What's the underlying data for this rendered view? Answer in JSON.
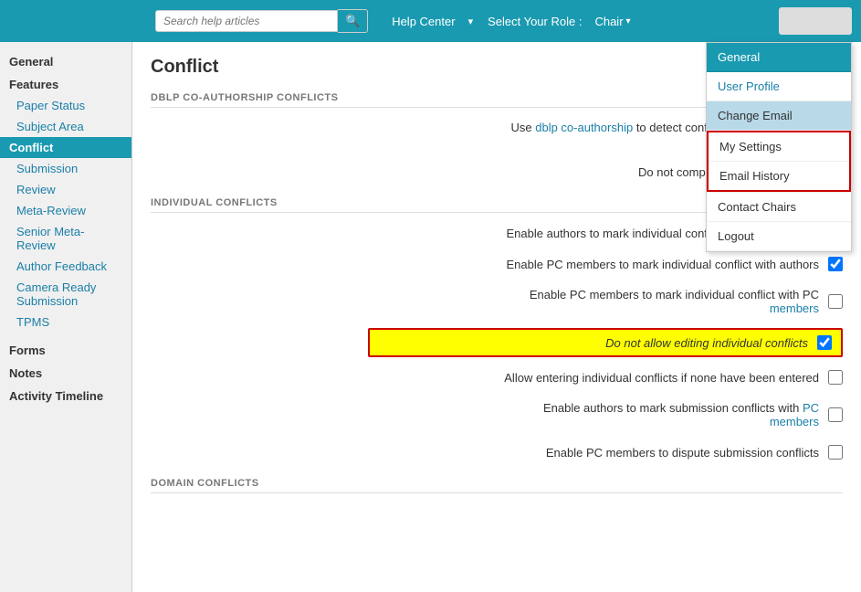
{
  "navbar": {
    "search_placeholder": "Search help articles",
    "help_center_label": "Help Center",
    "select_role_label": "Select Your Role :",
    "chair_label": "Chair",
    "search_icon": "🔍"
  },
  "dropdown": {
    "top_items": [
      {
        "id": "general",
        "label": "General",
        "active": true
      },
      {
        "id": "user-profile",
        "label": "User Profile"
      },
      {
        "id": "change-email",
        "label": "Change Email"
      }
    ],
    "section_items": [
      {
        "id": "my-settings",
        "label": "My Settings"
      },
      {
        "id": "email-history",
        "label": "Email History"
      }
    ],
    "bottom_items": [
      {
        "id": "contact-chairs",
        "label": "Contact Chairs"
      },
      {
        "id": "logout",
        "label": "Logout"
      }
    ]
  },
  "sidebar": {
    "sections": [
      {
        "id": "general",
        "label": "General",
        "items": []
      },
      {
        "id": "features",
        "label": "Features",
        "items": [
          {
            "id": "paper-status",
            "label": "Paper Status",
            "active": false
          },
          {
            "id": "subject-area",
            "label": "Subject Area",
            "active": false
          },
          {
            "id": "conflict",
            "label": "Conflict",
            "active": true
          },
          {
            "id": "submission",
            "label": "Submission",
            "active": false
          },
          {
            "id": "review",
            "label": "Review",
            "active": false
          },
          {
            "id": "meta-review",
            "label": "Meta-Review",
            "active": false
          },
          {
            "id": "senior-meta-review",
            "label": "Senior Meta-Review",
            "active": false
          },
          {
            "id": "author-feedback",
            "label": "Author Feedback",
            "active": false
          },
          {
            "id": "camera-ready",
            "label": "Camera Ready Submission",
            "active": false
          },
          {
            "id": "tpms",
            "label": "TPMS",
            "active": false
          }
        ]
      },
      {
        "id": "forms-section",
        "label": "Forms",
        "items": []
      },
      {
        "id": "notes-section",
        "label": "Notes",
        "items": []
      },
      {
        "id": "activity-timeline-section",
        "label": "Activity Timeline",
        "items": []
      }
    ]
  },
  "main": {
    "title": "Conflict",
    "dblp_section": {
      "header": "DBLP CO-AUTHORSHIP CONFLICTS",
      "rows": [
        {
          "id": "dblp-detect",
          "label": "Use dblp co-authorship to detect conflicts between authors and PC members",
          "checked": false
        },
        {
          "id": "dblp-no-compute",
          "label": "Do not compute new dblp conflicts",
          "checked": false
        }
      ]
    },
    "individual_section": {
      "header": "INDIVIDUAL CONFLICTS",
      "rows": [
        {
          "id": "authors-mark",
          "label": "Enable authors to mark individual conflict with PC members",
          "checked": true,
          "highlighted": false
        },
        {
          "id": "pc-mark-authors",
          "label": "Enable PC members to mark individual conflict with authors",
          "checked": true,
          "highlighted": false
        },
        {
          "id": "pc-mark-pc",
          "label": "Enable PC members to mark individual conflict with PC members",
          "checked": false,
          "highlighted": false
        },
        {
          "id": "no-edit",
          "label": "Do not allow editing individual conflicts",
          "checked": true,
          "highlighted": true
        },
        {
          "id": "allow-entering",
          "label": "Allow entering individual conflicts if none have been entered",
          "checked": false,
          "highlighted": false
        },
        {
          "id": "authors-submission",
          "label": "Enable authors to mark submission conflicts with PC members",
          "checked": false,
          "highlighted": false
        },
        {
          "id": "pc-dispute",
          "label": "Enable PC members to dispute submission conflicts",
          "checked": false,
          "highlighted": false
        }
      ]
    },
    "domain_section": {
      "header": "DOMAIN CONFLICTS"
    }
  }
}
